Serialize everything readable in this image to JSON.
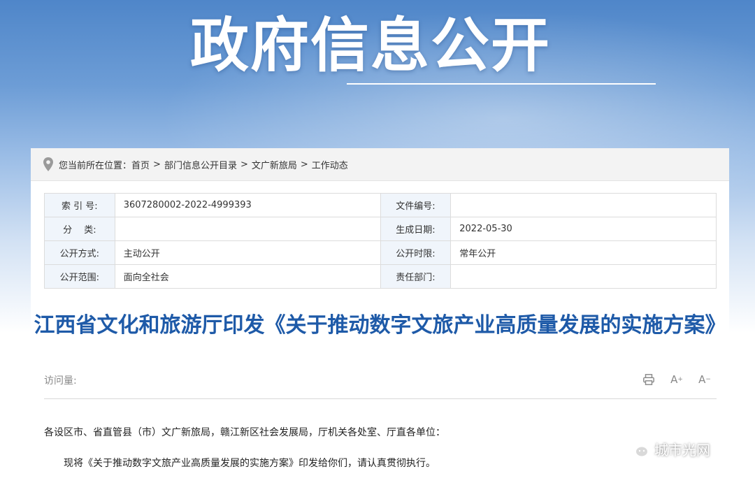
{
  "banner": {
    "title": "政府信息公开"
  },
  "breadcrumb": {
    "prefix": "您当前所在位置：",
    "items": [
      "首页",
      "部门信息公开目录",
      "文广新旅局",
      "工作动态"
    ],
    "separator": ">"
  },
  "info": {
    "rows": [
      {
        "l1": "索 引 号:",
        "v1": "3607280002-2022-4999393",
        "l2": "文件编号:",
        "v2": ""
      },
      {
        "l1": "分　 类:",
        "v1": "",
        "l2": "生成日期:",
        "v2": "2022-05-30"
      },
      {
        "l1": "公开方式:",
        "v1": "主动公开",
        "l2": "公开时限:",
        "v2": "常年公开"
      },
      {
        "l1": "公开范围:",
        "v1": "面向全社会",
        "l2": "责任部门:",
        "v2": ""
      }
    ]
  },
  "article": {
    "title": "江西省文化和旅游厅印发《关于推动数字文旅产业高质量发展的实施方案》",
    "visits_label": "访问量:",
    "font_increase": "A",
    "font_decrease": "A",
    "paragraphs": [
      "各设区市、省直管县（市）文广新旅局，赣江新区社会发展局，厅机关各处室、厅直各单位：",
      "现将《关于推动数字文旅产业高质量发展的实施方案》印发给你们，请认真贯彻执行。"
    ]
  },
  "watermark": {
    "text": "城市光网"
  }
}
